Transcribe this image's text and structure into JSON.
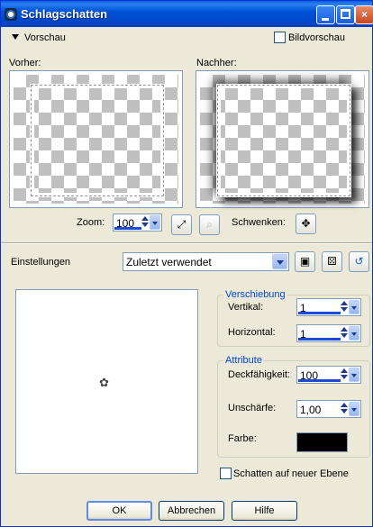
{
  "window": {
    "title": "Schlagschatten",
    "controls": {
      "minimize": "minimize",
      "maximize": "maximize",
      "close": "×"
    }
  },
  "preview": {
    "toggle_label": "Vorschau",
    "image_preview_label": "Bildvorschau",
    "image_preview_checked": false,
    "before_label": "Vorher:",
    "after_label": "Nachher:",
    "zoom_label": "Zoom:",
    "zoom_value": "100",
    "pan_label": "Schwenken:"
  },
  "settings": {
    "label": "Einstellungen",
    "preset_value": "Zuletzt verwendet"
  },
  "offset": {
    "title": "Verschiebung",
    "vertical_label": "Vertikal:",
    "vertical_value": "1",
    "horizontal_label": "Horizontal:",
    "horizontal_value": "1"
  },
  "attributes": {
    "title": "Attribute",
    "opacity_label": "Deckfähigkeit:",
    "opacity_value": "100",
    "blur_label": "Unschärfe:",
    "blur_value": "1,00",
    "color_label": "Farbe:",
    "color_hex": "#000000"
  },
  "shadow_new_layer": {
    "label": "Schatten auf neuer Ebene",
    "checked": false
  },
  "buttons": {
    "ok": "OK",
    "cancel": "Abbrechen",
    "help": "Hilfe"
  }
}
